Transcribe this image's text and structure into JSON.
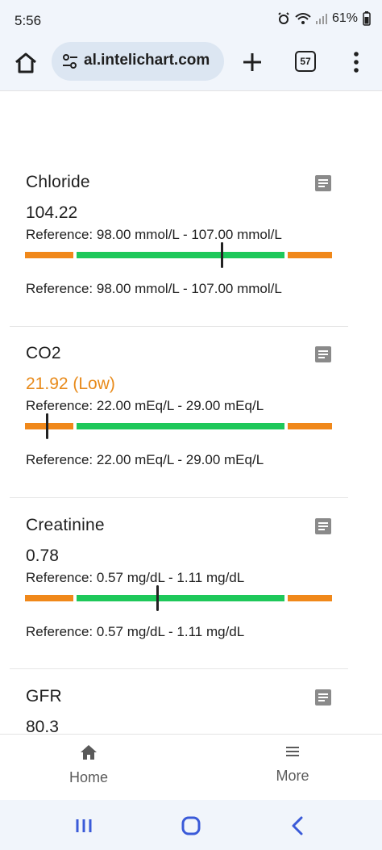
{
  "status_bar": {
    "time": "5:56",
    "battery": "61%"
  },
  "browser": {
    "url": "al.intelichart.com",
    "tab_count": "57"
  },
  "labs": [
    {
      "name": "Chloride",
      "value": "104.22",
      "status": "normal",
      "reference": "Reference: 98.00 mmol/L - 107.00 mmol/L",
      "reference_repeat": "Reference: 98.00 mmol/L - 107.00 mmol/L",
      "marker_fraction": 0.64
    },
    {
      "name": "CO2",
      "value": "21.92 (Low)",
      "status": "low",
      "reference": "Reference: 22.00 mEq/L - 29.00 mEq/L",
      "reference_repeat": "Reference: 22.00 mEq/L - 29.00 mEq/L",
      "marker_fraction": 0.07
    },
    {
      "name": "Creatinine",
      "value": "0.78",
      "status": "normal",
      "reference": "Reference: 0.57 mg/dL - 1.11 mg/dL",
      "reference_repeat": "Reference: 0.57 mg/dL - 1.11 mg/dL",
      "marker_fraction": 0.43
    },
    {
      "name": "GFR",
      "value": "80.3",
      "status": "normal"
    }
  ],
  "app_nav": {
    "home_label": "Home",
    "more_label": "More"
  },
  "colors": {
    "low": "#f0881a",
    "normal": "#1ec85a",
    "low_text": "#e88a1a"
  }
}
